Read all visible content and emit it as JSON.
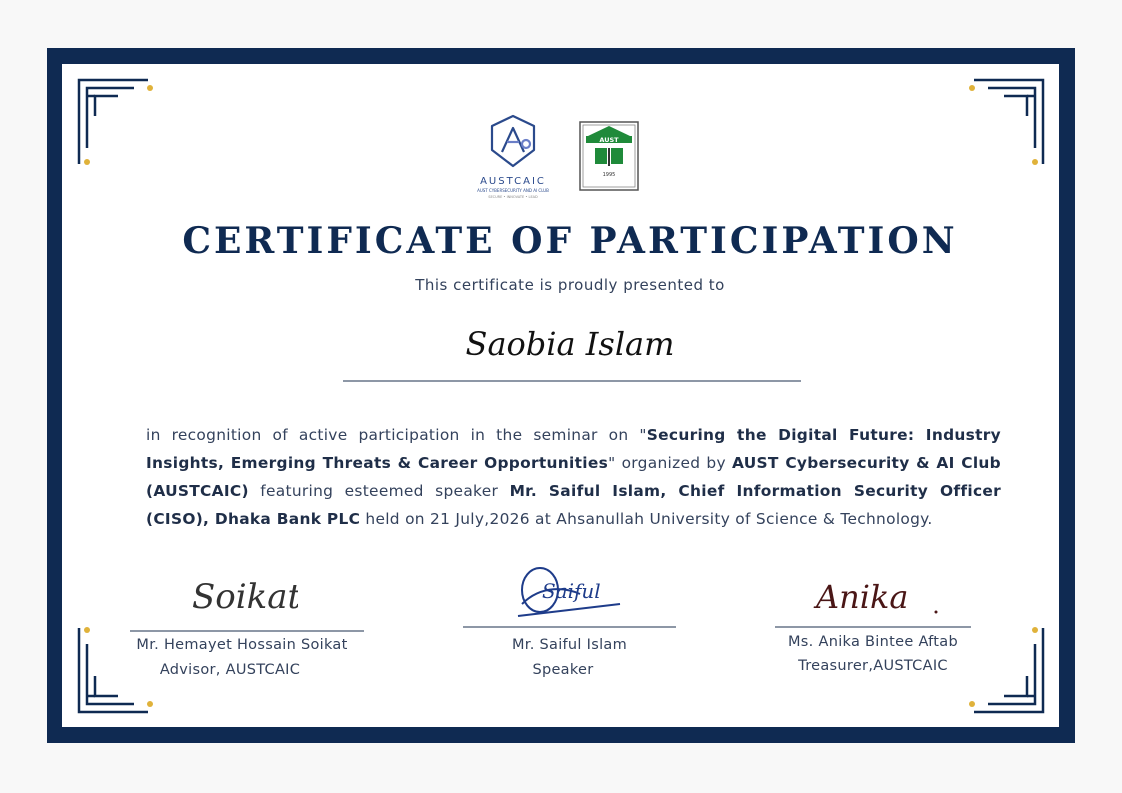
{
  "certificate": {
    "title": "CERTIFICATE OF PARTICIPATION",
    "subtitle": "This certificate is proudly presented to",
    "recipient": "Saobia Islam",
    "body": {
      "intro": "in recognition of active participation in the seminar on \"",
      "seminar": "Securing the Digital Future: Industry Insights, Emerging Threats & Career Opportunities",
      "organized_by_prefix": "\" organized by ",
      "organizer": "AUST Cybersecurity & AI Club (AUSTCAIC)",
      "speaker_prefix": " featuring esteemed speaker ",
      "speaker": "Mr. Saiful Islam, Chief Information Security Officer (CISO), Dhaka Bank PLC",
      "held_on": " held on 21 July,2026  at Ahsanullah University of Science & Technology."
    }
  },
  "logos": {
    "austcaic": {
      "name": "AUSTCAIC",
      "tagline": "AUST CYBERSECURITY AND AI CLUB",
      "motto": "SECURE • INNOVATE • LEAD",
      "icon": "austcaic-logo-icon"
    },
    "aust": {
      "name": "AUST",
      "year": "1995",
      "icon": "aust-seal-icon"
    }
  },
  "signatories": [
    {
      "name": "Mr. Hemayet Hossain Soikat",
      "role": "Advisor, AUSTCAIC",
      "signature_text": "Soikat"
    },
    {
      "name": "Mr. Saiful Islam",
      "role": "Speaker",
      "signature_text": "Saiful"
    },
    {
      "name": "Ms. Anika Bintee Aftab",
      "role": "Treasurer,AUSTCAIC",
      "signature_text": "Anika"
    }
  ],
  "colors": {
    "frame": "#0f2a52",
    "title": "#0f2a52",
    "ornament_gold": "#e0b23a",
    "text": "#34425c"
  }
}
